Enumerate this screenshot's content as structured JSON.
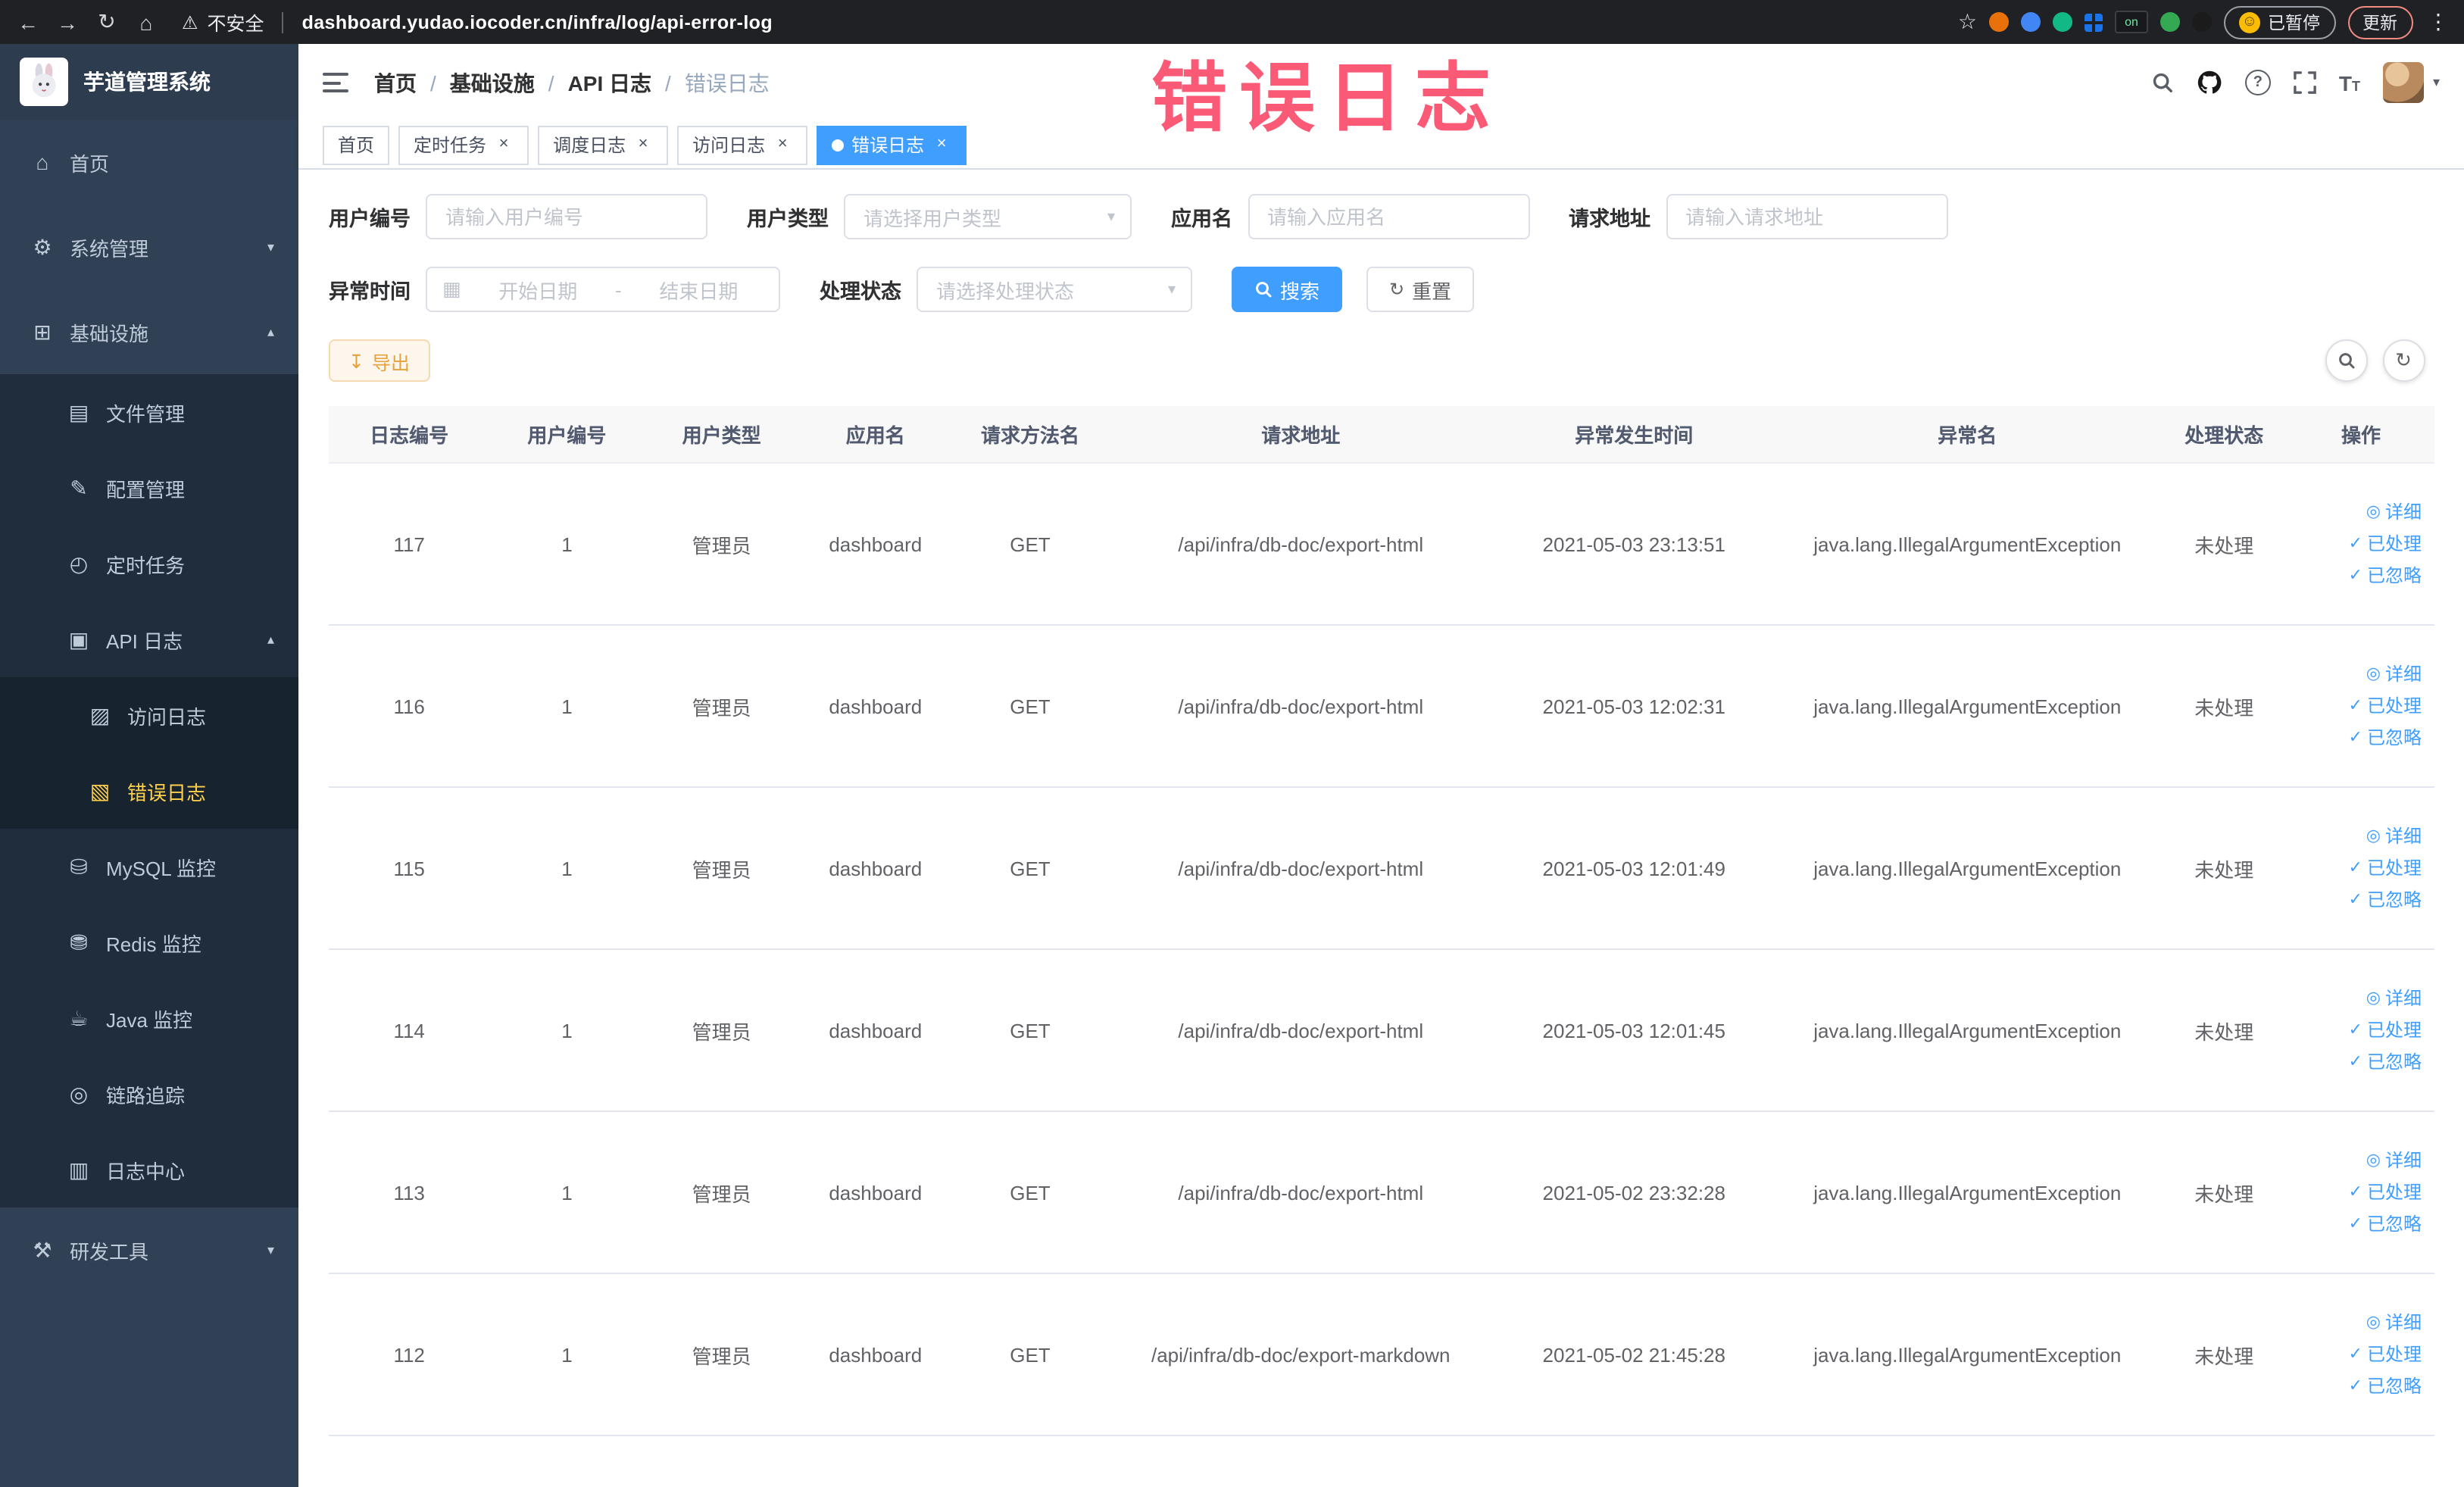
{
  "browser": {
    "security_label": "不安全",
    "url": "dashboard.yudao.iocoder.cn/infra/log/api-error-log",
    "on_badge": "on",
    "paused_label": "已暂停",
    "update_label": "更新"
  },
  "annotation": "错误日志",
  "icons": {
    "back": "←",
    "forward": "→",
    "reload": "↻",
    "home": "⌂",
    "warning": "⚠",
    "star": "☆",
    "kebab": "⋮",
    "smiley": "☺",
    "caret_down": "▾",
    "caret_up": "▴",
    "close": "×",
    "calendar": "▦",
    "download": "↧",
    "refresh": "↻",
    "eye": "◎",
    "check": "✓"
  },
  "sidebar": {
    "logo_title": "芋道管理系统",
    "items": [
      {
        "label": "首页",
        "glyph": "⌂"
      },
      {
        "label": "系统管理",
        "glyph": "⚙"
      },
      {
        "label": "基础设施",
        "glyph": "⊞"
      },
      {
        "label": "文件管理",
        "glyph": "▤"
      },
      {
        "label": "配置管理",
        "glyph": "✎"
      },
      {
        "label": "定时任务",
        "glyph": "◴"
      },
      {
        "label": "API 日志",
        "glyph": "▣"
      },
      {
        "label": "访问日志",
        "glyph": "▨"
      },
      {
        "label": "错误日志",
        "glyph": "▧"
      },
      {
        "label": "MySQL 监控",
        "glyph": "⛁"
      },
      {
        "label": "Redis 监控",
        "glyph": "⛃"
      },
      {
        "label": "Java 监控",
        "glyph": "☕"
      },
      {
        "label": "链路追踪",
        "glyph": "◎"
      },
      {
        "label": "日志中心",
        "glyph": "▥"
      },
      {
        "label": "研发工具",
        "glyph": "⚒"
      }
    ]
  },
  "breadcrumb": [
    "首页",
    "基础设施",
    "API 日志",
    "错误日志"
  ],
  "tabs": [
    {
      "label": "首页"
    },
    {
      "label": "定时任务"
    },
    {
      "label": "调度日志"
    },
    {
      "label": "访问日志"
    },
    {
      "label": "错误日志"
    }
  ],
  "filters": {
    "user_id": {
      "label": "用户编号",
      "placeholder": "请输入用户编号"
    },
    "user_type": {
      "label": "用户类型",
      "placeholder": "请选择用户类型"
    },
    "app_name": {
      "label": "应用名",
      "placeholder": "请输入应用名"
    },
    "request_url": {
      "label": "请求地址",
      "placeholder": "请输入请求地址"
    },
    "exception_time": {
      "label": "异常时间",
      "start_placeholder": "开始日期",
      "separator": "-",
      "end_placeholder": "结束日期"
    },
    "process_status": {
      "label": "处理状态",
      "placeholder": "请选择处理状态"
    },
    "search_label": "搜索",
    "reset_label": "重置"
  },
  "toolbar": {
    "export_label": "导出"
  },
  "table": {
    "columns": [
      "日志编号",
      "用户编号",
      "用户类型",
      "应用名",
      "请求方法名",
      "请求地址",
      "异常发生时间",
      "异常名",
      "处理状态",
      "操作"
    ],
    "actions": [
      "详细",
      "已处理",
      "已忽略"
    ],
    "rows": [
      {
        "id": "117",
        "user_id": "1",
        "user_type": "管理员",
        "app": "dashboard",
        "method": "GET",
        "url": "/api/infra/db-doc/export-html",
        "time": "2021-05-03 23:13:51",
        "exception": "java.lang.IllegalArgumentException",
        "status": "未处理"
      },
      {
        "id": "116",
        "user_id": "1",
        "user_type": "管理员",
        "app": "dashboard",
        "method": "GET",
        "url": "/api/infra/db-doc/export-html",
        "time": "2021-05-03 12:02:31",
        "exception": "java.lang.IllegalArgumentException",
        "status": "未处理"
      },
      {
        "id": "115",
        "user_id": "1",
        "user_type": "管理员",
        "app": "dashboard",
        "method": "GET",
        "url": "/api/infra/db-doc/export-html",
        "time": "2021-05-03 12:01:49",
        "exception": "java.lang.IllegalArgumentException",
        "status": "未处理"
      },
      {
        "id": "114",
        "user_id": "1",
        "user_type": "管理员",
        "app": "dashboard",
        "method": "GET",
        "url": "/api/infra/db-doc/export-html",
        "time": "2021-05-03 12:01:45",
        "exception": "java.lang.IllegalArgumentException",
        "status": "未处理"
      },
      {
        "id": "113",
        "user_id": "1",
        "user_type": "管理员",
        "app": "dashboard",
        "method": "GET",
        "url": "/api/infra/db-doc/export-html",
        "time": "2021-05-02 23:32:28",
        "exception": "java.lang.IllegalArgumentException",
        "status": "未处理"
      },
      {
        "id": "112",
        "user_id": "1",
        "user_type": "管理员",
        "app": "dashboard",
        "method": "GET",
        "url": "/api/infra/db-doc/export-markdown",
        "time": "2021-05-02 21:45:28",
        "exception": "java.lang.IllegalArgumentException",
        "status": "未处理"
      }
    ]
  }
}
